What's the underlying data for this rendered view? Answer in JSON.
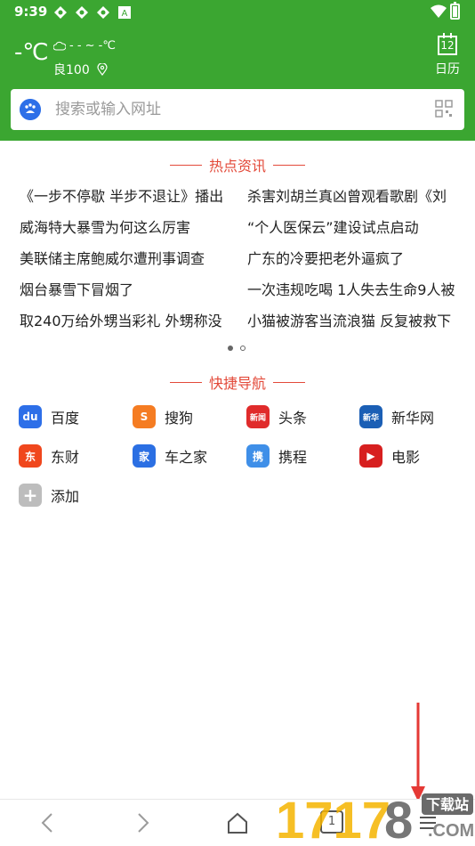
{
  "status": {
    "time": "9:39",
    "icons": [
      "app-icon-1",
      "app-icon-2",
      "app-icon-3",
      "a-icon",
      "wifi-icon",
      "battery-icon"
    ]
  },
  "weather": {
    "temp": "-℃",
    "cloud": "- - ~ -℃",
    "aqi": "良100"
  },
  "calendar": {
    "day": "12",
    "label": "日历"
  },
  "search": {
    "placeholder": "搜索或输入网址"
  },
  "hot": {
    "title": "热点资讯",
    "rows": [
      [
        "《一步不停歇 半步不退让》播出",
        "杀害刘胡兰真凶曾观看歌剧《刘"
      ],
      [
        "威海特大暴雪为何这么厉害",
        "“个人医保云”建设试点启动"
      ],
      [
        "美联储主席鲍威尔遭刑事调查",
        "广东的冷要把老外逼疯了"
      ],
      [
        "烟台暴雪下冒烟了",
        "一次违规吃喝 1人失去生命9人被"
      ],
      [
        "取240万给外甥当彩礼 外甥称没",
        "小猫被游客当流浪猫 反复被救下"
      ]
    ]
  },
  "quicknav": {
    "title": "快捷导航",
    "items": [
      {
        "label": "百度",
        "icon": "baidu-icon",
        "color": "#2d6fe8",
        "glyph": "du"
      },
      {
        "label": "搜狗",
        "icon": "sogou-icon",
        "color": "#f57c22",
        "glyph": "S"
      },
      {
        "label": "头条",
        "icon": "toutiao-icon",
        "color": "#e02b2b",
        "glyph": "新闻"
      },
      {
        "label": "新华网",
        "icon": "xinhua-icon",
        "color": "#1b5fb5",
        "glyph": "新华"
      },
      {
        "label": "东财",
        "icon": "dongcai-icon",
        "color": "#f0471d",
        "glyph": "东"
      },
      {
        "label": "车之家",
        "icon": "car-home-icon",
        "color": "#2b6fe3",
        "glyph": "家"
      },
      {
        "label": "携程",
        "icon": "ctrip-icon",
        "color": "#3f8fe8",
        "glyph": "携"
      },
      {
        "label": "电影",
        "icon": "movie-icon",
        "color": "#d71f1f",
        "glyph": "▶"
      },
      {
        "label": "添加",
        "icon": "add-icon",
        "color": "#bdbdbd",
        "glyph": "+"
      }
    ]
  },
  "bottom": {
    "tabs": "1"
  },
  "watermark": {
    "text": "下载站",
    "sub": "1717…COM"
  }
}
